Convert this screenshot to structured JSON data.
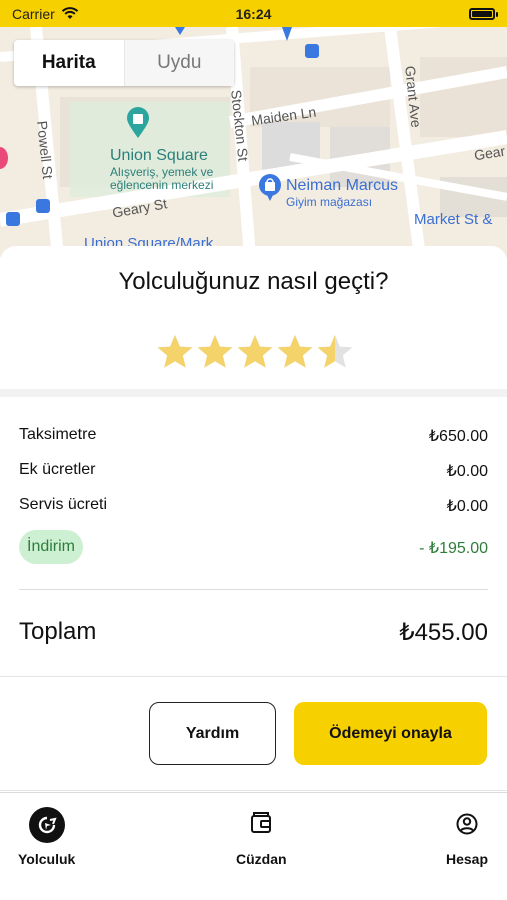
{
  "status_bar": {
    "carrier": "Carrier",
    "time": "16:24"
  },
  "map": {
    "toggle": {
      "map_label": "Harita",
      "satellite_label": "Uydu"
    },
    "streets": {
      "powell": "Powell St",
      "stockton": "Stockton St",
      "grant": "Grant Ave",
      "maiden": "Maiden Ln",
      "geary": "Geary St",
      "geary_right": "Gear",
      "market": "Market St &"
    },
    "union_square": {
      "title": "Union Square",
      "subtitle_line1": "Alışveriş, yemek ve",
      "subtitle_line2": "eğlencenin merkezi"
    },
    "neiman": {
      "title": "Neiman Marcus",
      "subtitle": "Giyim mağazası"
    },
    "partial_label": "Union Square/Mark"
  },
  "rating": {
    "question": "Yolculuğunuz nasıl geçti?",
    "value": 4.5,
    "max": 5,
    "star_color": "#F5D36B",
    "empty_star_color": "#E2E2E2"
  },
  "fare": {
    "rows": [
      {
        "label": "Taksimetre",
        "value": "₺650.00"
      },
      {
        "label": "Ek ücretler",
        "value": "₺0.00"
      },
      {
        "label": "Servis ücreti",
        "value": "₺0.00"
      }
    ],
    "discount": {
      "label": "İndirim",
      "value": "- ₺195.00"
    },
    "total": {
      "label": "Toplam",
      "value": "₺455.00"
    }
  },
  "actions": {
    "help_label": "Yardım",
    "confirm_label": "Ödemeyi onayla"
  },
  "tabs": {
    "ride": {
      "label": "Yolculuk",
      "icon": "ride-icon"
    },
    "wallet": {
      "label": "Cüzdan",
      "icon": "wallet-icon"
    },
    "account": {
      "label": "Hesap",
      "icon": "account-icon"
    }
  },
  "colors": {
    "brand_yellow": "#F7D000",
    "discount_green": "#2F7D3C",
    "discount_bg": "#CDEFD2"
  }
}
